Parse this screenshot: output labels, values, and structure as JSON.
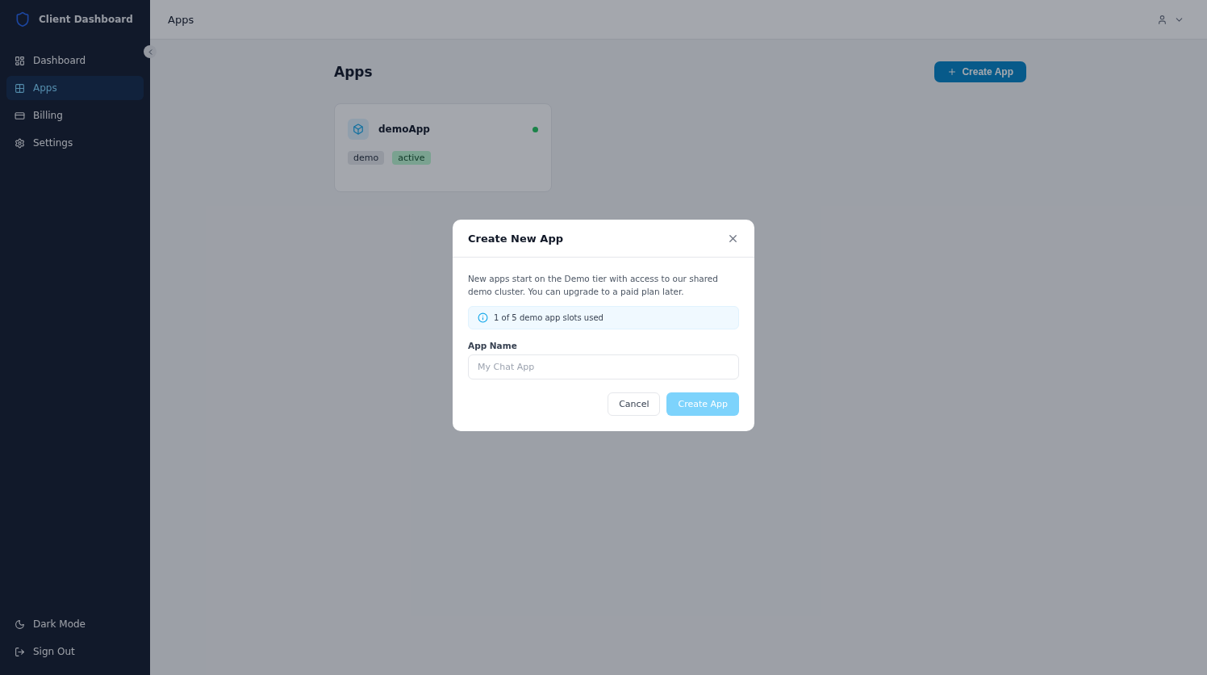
{
  "sidebar": {
    "brand": "Client Dashboard",
    "items": [
      {
        "label": "Dashboard",
        "selected": false
      },
      {
        "label": "Apps",
        "selected": true
      },
      {
        "label": "Billing",
        "selected": false
      },
      {
        "label": "Settings",
        "selected": false
      }
    ],
    "footer_items": [
      "Dark Mode",
      "Sign Out"
    ]
  },
  "header": {
    "breadcrumb": "Apps"
  },
  "page": {
    "title": "Apps",
    "create_button": "Create App",
    "apps": [
      {
        "name": "demoApp",
        "tags": [
          {
            "label": "demo",
            "kind": "tier"
          },
          {
            "label": "active",
            "kind": "status"
          }
        ],
        "online": true
      }
    ]
  },
  "dialog": {
    "title": "Create New App",
    "description": "New apps start on the Demo tier with access to our shared demo cluster. You can upgrade to a paid plan later.",
    "notice": "1 of 5 demo app slots used",
    "field": {
      "label": "App Name",
      "placeholder": "My Chat App"
    },
    "buttons": [
      {
        "label": "Cancel",
        "kind": "secondary"
      },
      {
        "label": "Create App",
        "kind": "primary",
        "disabled": true
      }
    ]
  }
}
